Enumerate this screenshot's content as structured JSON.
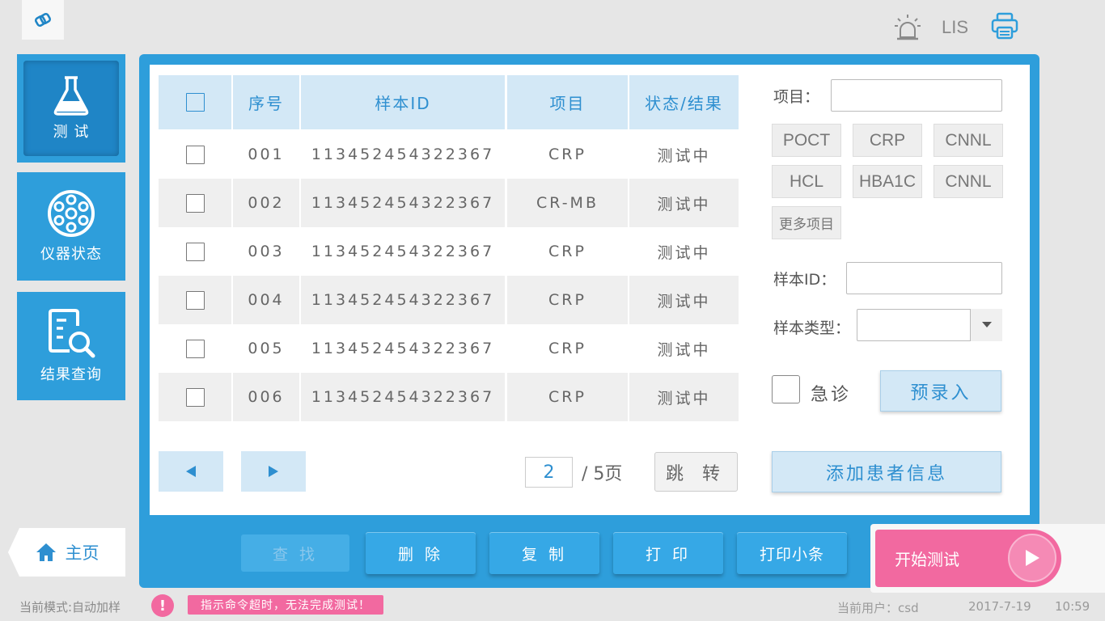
{
  "header": {
    "lis_label": "LIS"
  },
  "nav": {
    "test": "测 试",
    "instrument_status": "仪器状态",
    "result_query": "结果查询",
    "home": "主页"
  },
  "table": {
    "headers": [
      "序号",
      "样本ID",
      "项目",
      "状态/结果"
    ],
    "rows": [
      {
        "no": "001",
        "sample_id": "113452454322367",
        "item": "CRP",
        "status": "测试中"
      },
      {
        "no": "002",
        "sample_id": "113452454322367",
        "item": "CR-MB",
        "status": "测试中"
      },
      {
        "no": "003",
        "sample_id": "113452454322367",
        "item": "CRP",
        "status": "测试中"
      },
      {
        "no": "004",
        "sample_id": "113452454322367",
        "item": "CRP",
        "status": "测试中"
      },
      {
        "no": "005",
        "sample_id": "113452454322367",
        "item": "CRP",
        "status": "测试中"
      },
      {
        "no": "006",
        "sample_id": "113452454322367",
        "item": "CRP",
        "status": "测试中"
      }
    ]
  },
  "pagination": {
    "current": "2",
    "total_label": "/ 5页",
    "jump_label": "跳 转"
  },
  "form": {
    "item_label": "项目：",
    "chips": [
      "POCT",
      "CRP",
      "CNNL",
      "HCL",
      "HBA1C",
      "CNNL"
    ],
    "more_items": "更多项目",
    "sample_id_label": "样本ID：",
    "sample_type_label": "样本类型：",
    "urgent_label": "急诊",
    "pre_entry": "预录入",
    "add_patient": "添加患者信息"
  },
  "actions": {
    "find": "查 找",
    "delete": "删 除",
    "copy": "复 制",
    "print": "打 印",
    "print_slip": "打印小条"
  },
  "start_test": "开始测试",
  "status_bar": {
    "mode": "当前模式:自动加样",
    "alert_icon": "!",
    "message": "指示命令超时，无法完成测试！",
    "user": "当前用户：csd",
    "date": "2017-7-19",
    "time": "10:59"
  },
  "colors": {
    "accent": "#2e9edb",
    "header_bg": "#d3e8f6",
    "start": "#f269a0"
  }
}
